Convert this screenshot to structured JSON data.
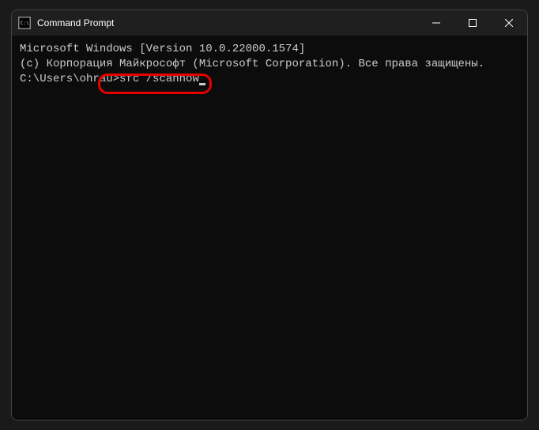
{
  "titlebar": {
    "title": "Command Prompt"
  },
  "terminal": {
    "line1": "Microsoft Windows [Version 10.0.22000.1574]",
    "line2": "(c) Корпорация Майкрософт (Microsoft Corporation). Все права защищены.",
    "blank": "",
    "prompt": "C:\\Users\\ohrau>",
    "command": "sfc /scannow"
  }
}
